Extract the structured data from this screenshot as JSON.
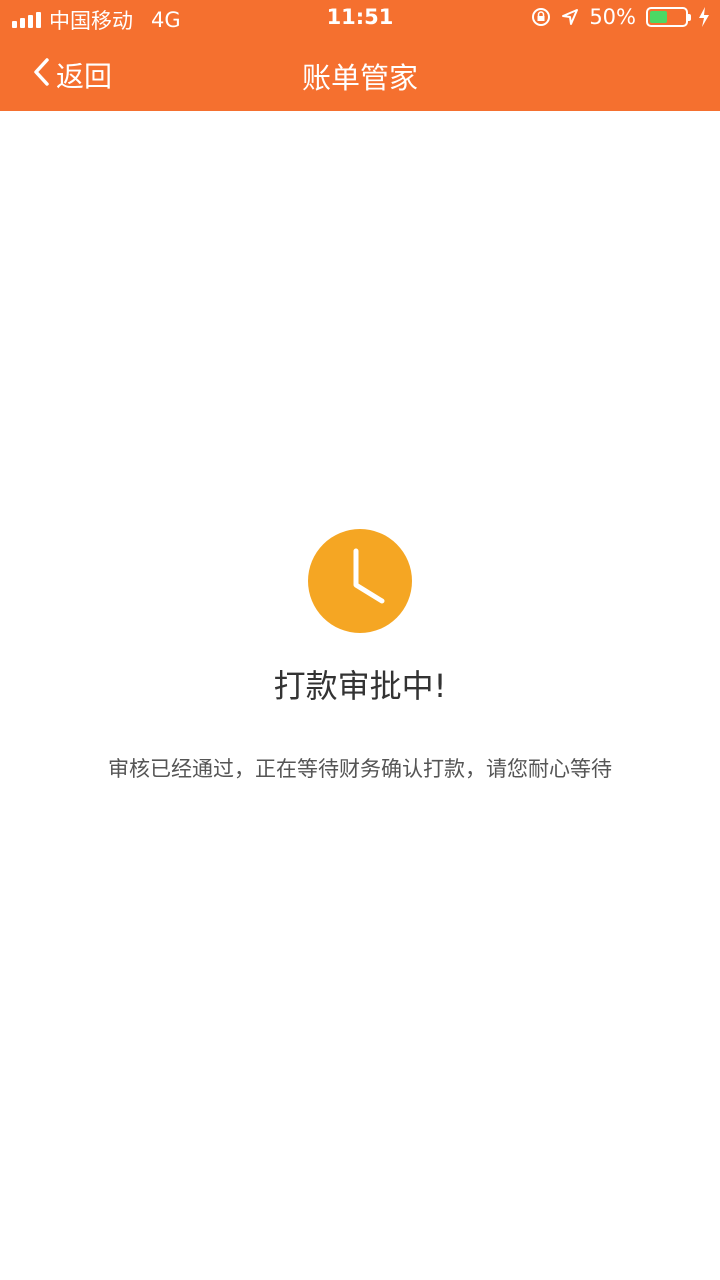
{
  "status_bar": {
    "carrier": "中国移动",
    "network": "4G",
    "time": "11:51",
    "battery_percent": "50%",
    "battery_level": 0.5,
    "icons": [
      "signal-icon",
      "orientation-lock-icon",
      "location-arrow-icon",
      "battery-icon",
      "charging-bolt-icon"
    ]
  },
  "nav": {
    "back_label": "返回",
    "title": "账单管家"
  },
  "main": {
    "icon": "clock-icon",
    "title": "打款审批中!",
    "description": "审核已经通过，正在等待财务确认打款，请您耐心等待"
  },
  "colors": {
    "brand": "#f5702f",
    "clock": "#f5a623",
    "battery": "#4cd964"
  }
}
